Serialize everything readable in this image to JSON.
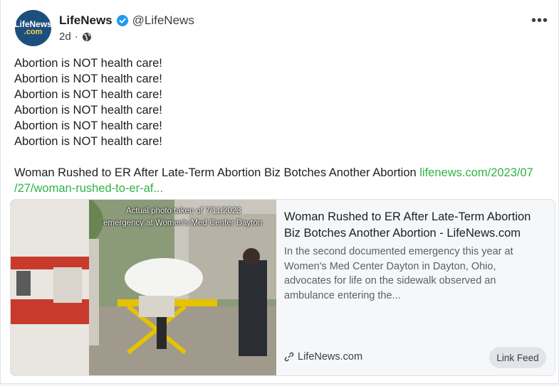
{
  "author": {
    "avatar_line1": "LifeNews",
    "avatar_line2": ".com",
    "name": "LifeNews",
    "handle": "@LifeNews",
    "time": "2d",
    "dot": "·"
  },
  "post": {
    "lines": [
      "Abortion is NOT health care!",
      "Abortion is NOT health care!",
      "Abortion is NOT health care!",
      "Abortion is NOT health care!",
      "Abortion is NOT health care!",
      "Abortion is NOT health care!"
    ],
    "headline": "Woman Rushed to ER After Late-Term Abortion Biz Botches Another Abortion ",
    "link_part1": "lifenews.com/2023/07",
    "link_part2": "/27/woman-rushed-to-er-af..."
  },
  "preview": {
    "image_caption_line1": "Actual photo taken of 7/11/2023",
    "image_caption_line2": "emergency at Women's Med Center Dayton",
    "title": "Woman Rushed to ER After Late-Term Abortion Biz Botches Another Abortion - LifeNews.com",
    "description": "In the second documented emergency this year at Women's Med Center Dayton in Dayton, Ohio, advocates for life on the sidewalk observed an ambulance entering the...",
    "domain": "LifeNews.com",
    "button": "Link Feed"
  },
  "icons": {
    "verified": "verified-badge-icon",
    "globe": "globe-icon",
    "more": "more-options-icon",
    "link": "link-icon"
  },
  "colors": {
    "link": "#2fb344",
    "verified": "#1d9bf0",
    "avatar_bg": "#1d4f7c"
  }
}
